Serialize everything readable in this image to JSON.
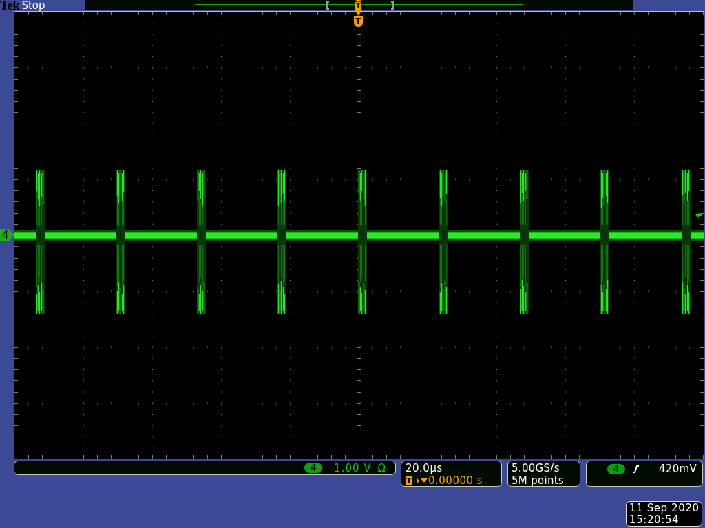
{
  "header": {
    "brand": "Tek",
    "run_state": "Stop"
  },
  "record_view": {
    "trigger_marker": "T"
  },
  "graticule": {
    "trigger_marker": "T",
    "channel_marker": "4"
  },
  "vertical_readout": {
    "channel": "4",
    "scale": "1.00 V",
    "termination": "Ω"
  },
  "horizontal_readout": {
    "scale": "20.0µs",
    "trigger_marker": "T",
    "position": "0.00000 s"
  },
  "acquisition_readout": {
    "sample_rate": "5.00GS/s",
    "record_length": "5M points"
  },
  "trigger_readout": {
    "channel": "4",
    "rising_edge": true,
    "threshold": "420mV"
  },
  "datetime": {
    "date": "11 Sep 2020",
    "time": "15:20:54"
  }
}
